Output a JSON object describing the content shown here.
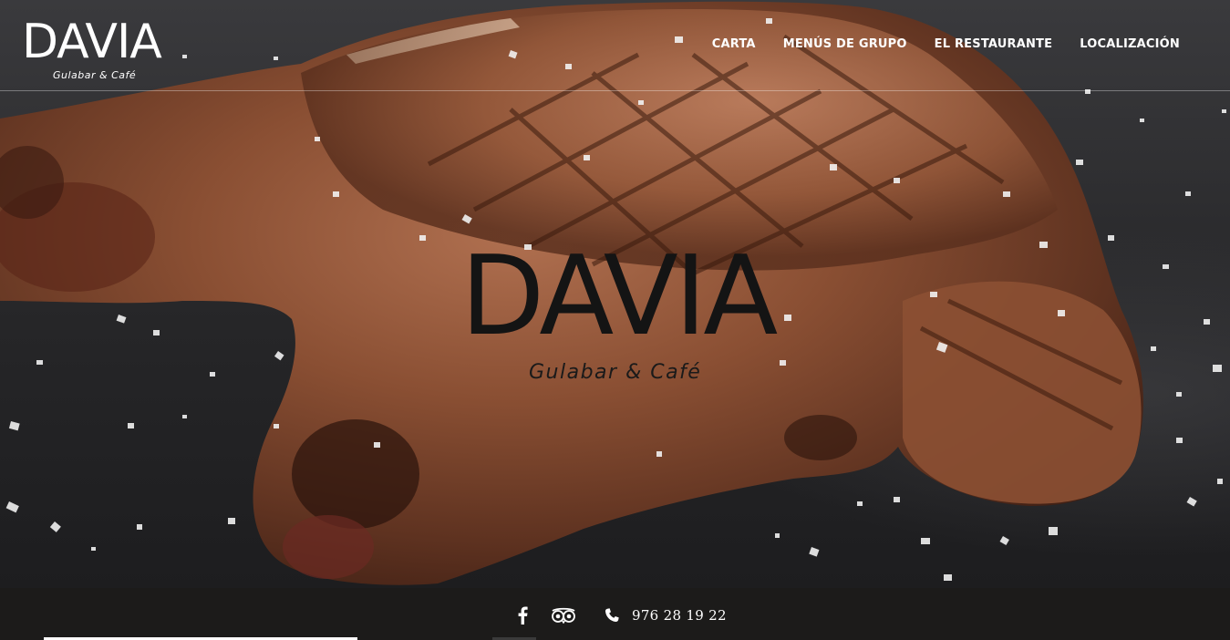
{
  "brand": {
    "name": "DAVIA",
    "tagline": "Gulabar & Café"
  },
  "nav": {
    "items": [
      "CARTA",
      "MENÚS DE GRUPO",
      "EL RESTAURANTE",
      "LOCALIZACIÓN"
    ]
  },
  "hero": {
    "logo_name": "DAVIA",
    "logo_tagline": "Gulabar & Café",
    "image": "grilled-steak-with-salt"
  },
  "footer": {
    "icons": [
      "facebook-icon",
      "tripadvisor-icon",
      "phone-icon"
    ],
    "phone": "976 28 19 22"
  },
  "colors": {
    "header_text": "#ffffff",
    "center_logo": "#141414",
    "footer_bg": "#1c1b1a"
  }
}
